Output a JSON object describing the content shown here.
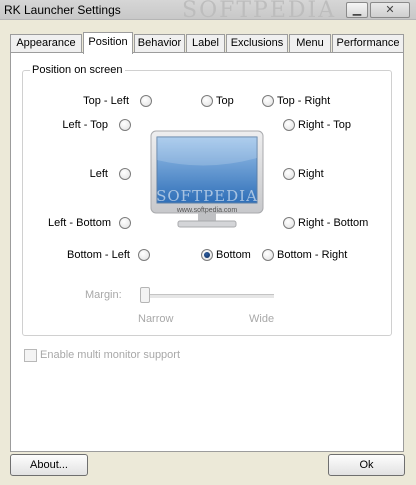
{
  "window": {
    "title": "RK Launcher Settings",
    "minimize_glyph": "▁",
    "close_glyph": "✕",
    "watermark": "SOFTPEDIA"
  },
  "tabs": [
    {
      "label": "Appearance"
    },
    {
      "label": "Position",
      "active": true
    },
    {
      "label": "Behavior"
    },
    {
      "label": "Label"
    },
    {
      "label": "Exclusions"
    },
    {
      "label": "Menu"
    },
    {
      "label": "Performance"
    }
  ],
  "position_group": {
    "title": "Position on screen",
    "selected": "Bottom",
    "options": {
      "top_left": "Top - Left",
      "top": "Top",
      "top_right": "Top - Right",
      "left_top": "Left - Top",
      "right_top": "Right - Top",
      "left": "Left",
      "right": "Right",
      "left_bottom": "Left - Bottom",
      "right_bottom": "Right - Bottom",
      "bottom_left": "Bottom - Left",
      "bottom": "Bottom",
      "bottom_right": "Bottom - Right"
    },
    "monitor_watermark": "SOFTPEDIA",
    "monitor_caption": "www.softpedia.com"
  },
  "margin": {
    "label": "Margin:",
    "min_label": "Narrow",
    "max_label": "Wide",
    "value": 0
  },
  "multi_monitor": {
    "label": "Enable multi monitor support",
    "checked": false
  },
  "buttons": {
    "about": "About...",
    "ok": "Ok"
  },
  "colors": {
    "screen_top": "#9cc3ea",
    "screen_bottom": "#2f6fb8",
    "monitor_frame": "#d9dadd",
    "radio_dot": "#0b2a5a"
  }
}
